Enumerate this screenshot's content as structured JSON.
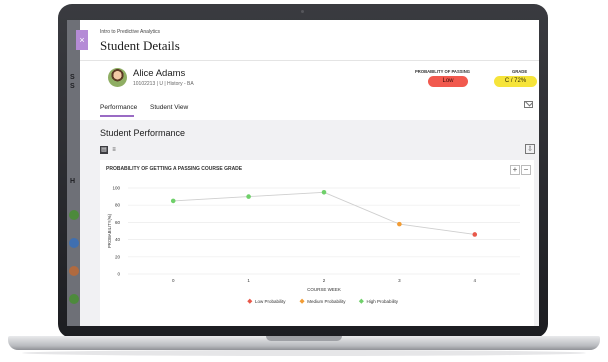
{
  "app": {
    "breadcrumb": "Intro to Predictive Analytics",
    "title": "Student Details",
    "close_glyph": "×"
  },
  "background": {
    "letters": [
      "S",
      "S",
      "H"
    ]
  },
  "student": {
    "name": "Alice Adams",
    "meta": "10102213 | U | History - BA"
  },
  "probability": {
    "label": "PROBABILITY OF PASSING",
    "value": "Low",
    "color": "#f1594e"
  },
  "grade": {
    "label": "GRADE",
    "value": "C / 72%",
    "color": "#f6e43a"
  },
  "tabs": [
    {
      "label": "Performance",
      "active": true
    },
    {
      "label": "Student View",
      "active": false
    }
  ],
  "section": {
    "title": "Student Performance",
    "chart_icon": "bar-chart-icon",
    "list_icon": "list-icon",
    "download_icon": "download-icon"
  },
  "chart_card": {
    "title": "PROBABILITY OF GETTING A PASSING COURSE GRADE",
    "zoom_in": "+",
    "zoom_out": "−"
  },
  "chart_data": {
    "type": "line",
    "title": "PROBABILITY OF GETTING A PASSING COURSE GRADE",
    "xlabel": "COURSE WEEK",
    "ylabel": "PROBABILITY(%)",
    "x": [
      0,
      1,
      2,
      3,
      4
    ],
    "y": [
      85,
      90,
      95,
      58,
      46
    ],
    "point_categories": [
      "High Probability",
      "High Probability",
      "High Probability",
      "Medium Probability",
      "Low Probability"
    ],
    "ylim": [
      0,
      100
    ],
    "yticks": [
      0,
      20,
      40,
      60,
      80,
      100
    ],
    "grid": true,
    "legend_position": "bottom",
    "legend": [
      {
        "name": "Low Probability",
        "color": "#e8584a"
      },
      {
        "name": "Medium Probability",
        "color": "#f29c34"
      },
      {
        "name": "High Probability",
        "color": "#6fd06a"
      }
    ],
    "line_color": "#cfcfcf"
  }
}
